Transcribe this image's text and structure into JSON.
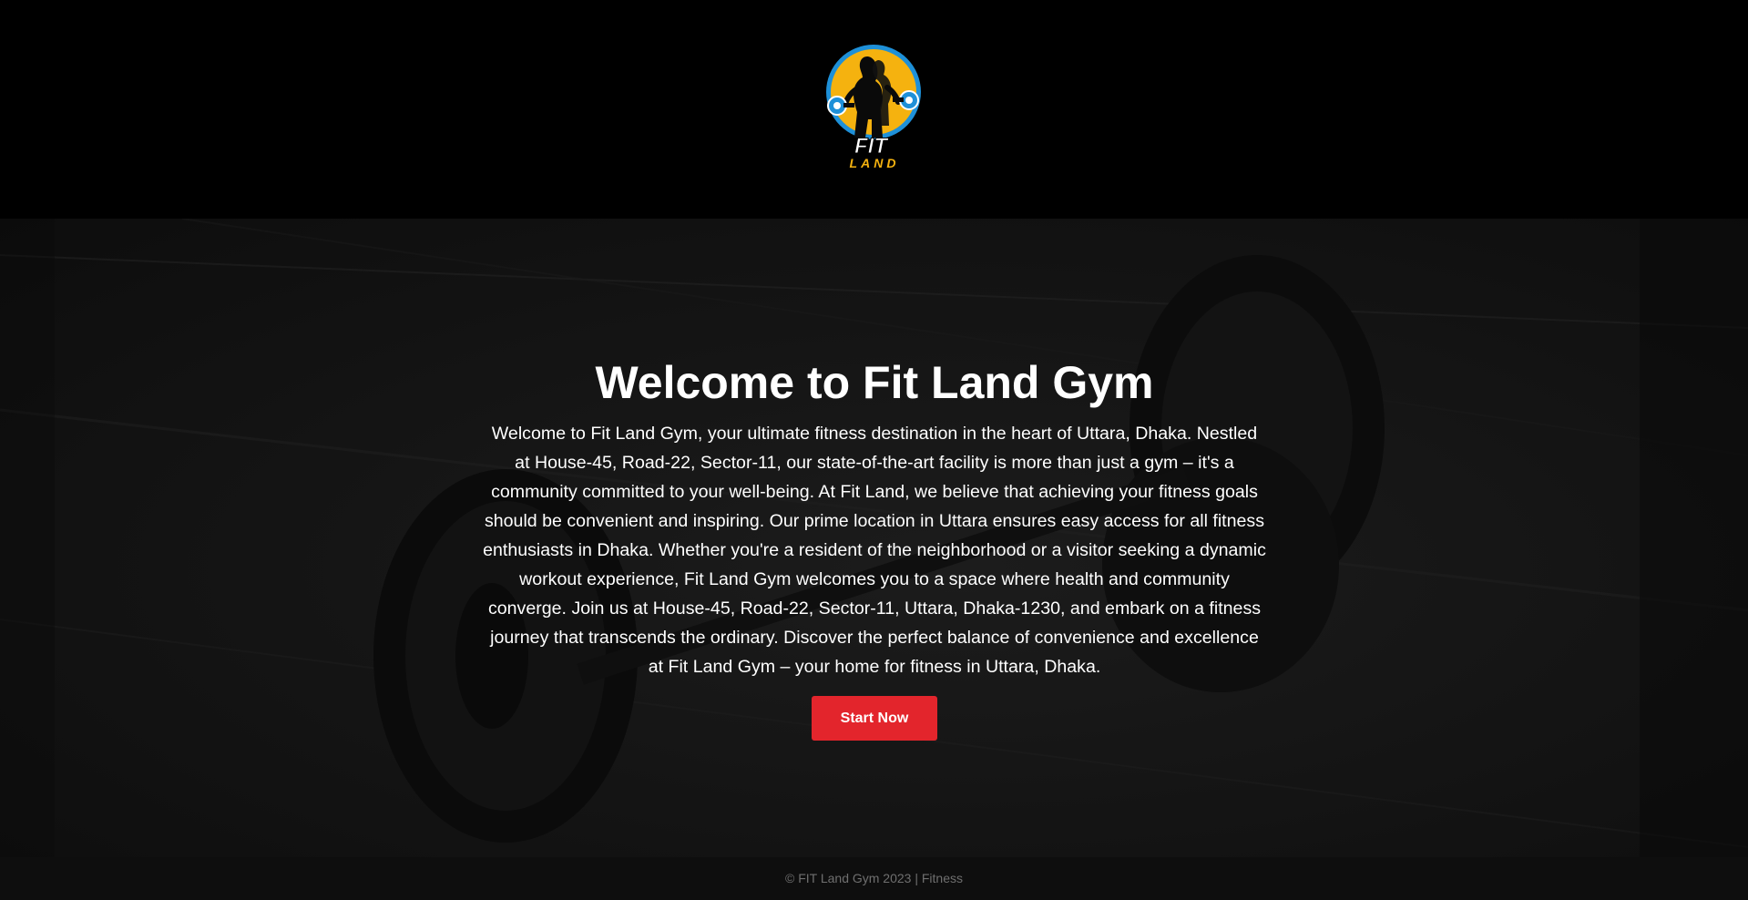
{
  "header": {
    "logo": {
      "icon": "fit-land-logo",
      "text_top": "FIT",
      "text_bottom": "LAND",
      "colors": {
        "ring": "#1e90d8",
        "fill": "#f5b20f",
        "figure": "#0a0a0a",
        "text": "#ffffff",
        "text_accent": "#f5b20f"
      }
    }
  },
  "hero": {
    "title": "Welcome to Fit Land Gym",
    "description": "Welcome to Fit Land Gym, your ultimate fitness destination in the heart of Uttara, Dhaka. Nestled at House-45, Road-22, Sector-11, our state-of-the-art facility is more than just a gym – it's a community committed to your well-being. At Fit Land, we believe that achieving your fitness goals should be convenient and inspiring. Our prime location in Uttara ensures easy access for all fitness enthusiasts in Dhaka. Whether you're a resident of the neighborhood or a visitor seeking a dynamic workout experience, Fit Land Gym welcomes you to a space where health and community converge. Join us at House-45, Road-22, Sector-11, Uttara, Dhaka-1230, and embark on a fitness journey that transcends the ordinary. Discover the perfect balance of convenience and excellence at Fit Land Gym – your home for fitness in Uttara, Dhaka.",
    "cta_label": "Start Now",
    "background_icon": "dumbbells-on-floor",
    "colors": {
      "cta": "#e3252c"
    }
  },
  "footer": {
    "text": "© FIT Land Gym 2023 | Fitness"
  }
}
